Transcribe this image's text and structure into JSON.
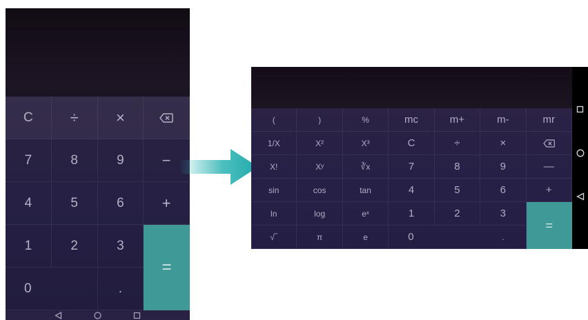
{
  "colors": {
    "equals_bg": "#3f9a97",
    "key_text": "#b6b0c6",
    "arrow": "#2bb3b3"
  },
  "portrait": {
    "keys": [
      "C",
      "÷",
      "×",
      "backspace-icon",
      "7",
      "8",
      "9",
      "−",
      "4",
      "5",
      "6",
      "+",
      "1",
      "2",
      "3",
      "=",
      "0",
      "."
    ],
    "labels": {
      "c": "C",
      "divide": "÷",
      "multiply": "×",
      "minus": "−",
      "plus": "+",
      "equals": "=",
      "d7": "7",
      "d8": "8",
      "d9": "9",
      "d4": "4",
      "d5": "5",
      "d6": "6",
      "d1": "1",
      "d2": "2",
      "d3": "3",
      "d0": "0",
      "dot": "."
    },
    "nav_icons": [
      "back-triangle-icon",
      "home-circle-icon",
      "recents-square-icon"
    ]
  },
  "landscape": {
    "row1": [
      "(",
      ")",
      "%",
      "mc",
      "m+",
      "m-",
      "mr"
    ],
    "row2": [
      "1/X",
      "X²",
      "X³",
      "C",
      "÷",
      "×"
    ],
    "row3": [
      "X!",
      "Xʸ",
      "∛x",
      "7",
      "8",
      "9",
      "—"
    ],
    "row4": [
      "sin",
      "cos",
      "tan",
      "4",
      "5",
      "6",
      "+"
    ],
    "row5": [
      "ln",
      "log",
      "eˣ",
      "1",
      "2",
      "3"
    ],
    "row6": [
      "√‾",
      "π",
      "e"
    ],
    "zero": "0",
    "dot": ".",
    "equals": "=",
    "nav_icons": [
      "recents-square-icon",
      "home-circle-icon",
      "back-triangle-icon"
    ]
  }
}
